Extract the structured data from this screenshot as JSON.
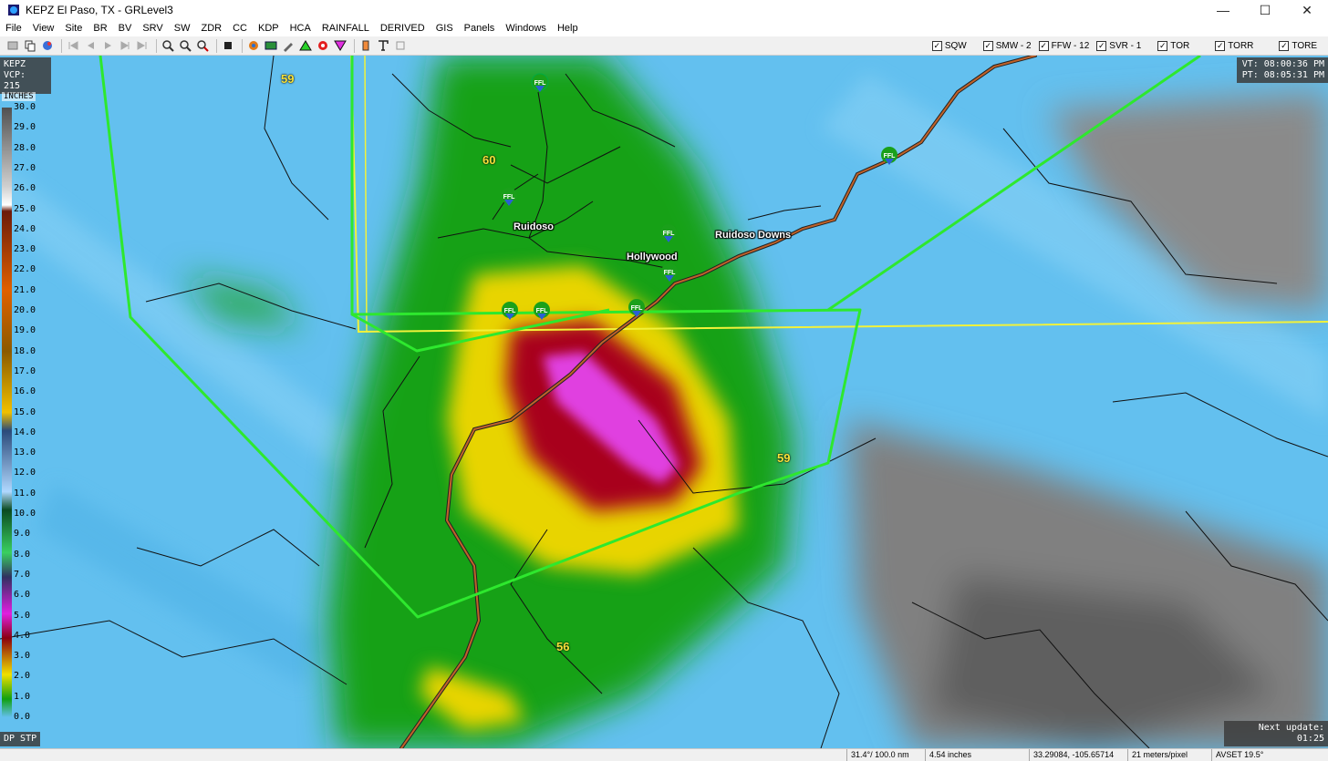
{
  "window": {
    "title": "KEPZ El Paso, TX - GRLevel3",
    "minimize": "—",
    "maximize": "☐",
    "close": "✕"
  },
  "menu": [
    "File",
    "View",
    "Site",
    "BR",
    "BV",
    "SRV",
    "SW",
    "ZDR",
    "CC",
    "KDP",
    "HCA",
    "RAINFALL",
    "DERIVED",
    "GIS",
    "Panels",
    "Windows",
    "Help"
  ],
  "warnings": [
    {
      "label": "SQW",
      "checked": true
    },
    {
      "label": "SMW - 2",
      "checked": true
    },
    {
      "label": "FFW - 12",
      "checked": true
    },
    {
      "label": "SVR - 1",
      "checked": true
    },
    {
      "label": "TOR",
      "checked": true
    },
    {
      "label": "TORR",
      "checked": true
    },
    {
      "label": "TORE",
      "checked": true
    }
  ],
  "check_glyph": "✓",
  "radar": {
    "site": "KEPZ",
    "vcp": "VCP: 215"
  },
  "times": {
    "vt": "VT: 08:00:36 PM",
    "pt": "PT: 08:05:31 PM"
  },
  "legend": {
    "unit": "INCHES",
    "ticks": [
      "30.0",
      "29.0",
      "28.0",
      "27.0",
      "26.0",
      "25.0",
      "24.0",
      "23.0",
      "22.0",
      "21.0",
      "20.0",
      "19.0",
      "18.0",
      "17.0",
      "16.0",
      "15.0",
      "14.0",
      "13.0",
      "12.0",
      "11.0",
      "10.0",
      "9.0",
      "8.0",
      "7.0",
      "6.0",
      "5.0",
      "4.0",
      "3.0",
      "2.0",
      "1.0",
      "0.0"
    ]
  },
  "product": "DP STP",
  "next_update": "Next update: 01:25",
  "map_labels": {
    "towns": [
      "Ruidoso",
      "Hollywood",
      "Ruidoso Downs"
    ],
    "highways": [
      "59",
      "60",
      "59",
      "56"
    ],
    "ffl_marker": "FFL"
  },
  "status": {
    "azimuth_range": "31.4°/ 100.0 nm",
    "value": "4.54 inches",
    "coords": "33.29084, -105.65714",
    "resolution": "21 meters/pixel",
    "avset": "AVSET 19.5°"
  },
  "colors": {
    "background_rain": "#63c0ef",
    "green": "#19a119",
    "yellow": "#e8d400",
    "red": "#a8001a",
    "magenta": "#e040e0",
    "gray": "#7a7a7a",
    "warning_polygon": "#2ee82e",
    "county_line": "#f2f23a",
    "road": "#c0622a"
  }
}
